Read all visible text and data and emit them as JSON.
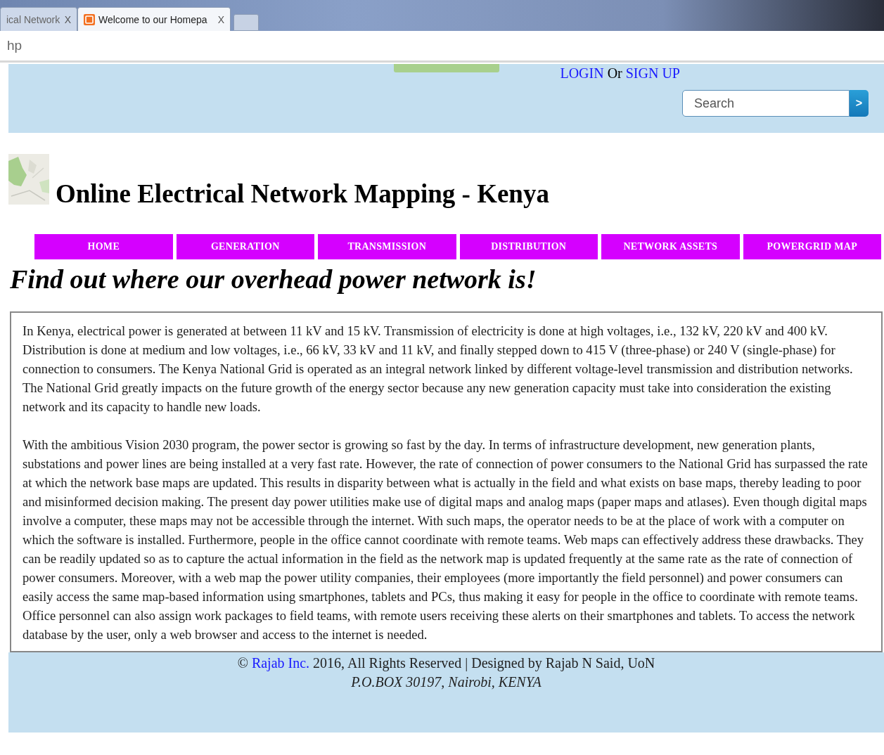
{
  "browser": {
    "tabs": [
      {
        "title": "ical Network",
        "close": "X",
        "selected": false
      },
      {
        "title": "Welcome to our Homepa",
        "close": "X",
        "selected": true
      }
    ],
    "address": "hp"
  },
  "header": {
    "login": "LOGIN",
    "or": "Or",
    "signup": "SIGN UP",
    "search": {
      "placeholder": "Search",
      "button": ">"
    }
  },
  "title": "Online Electrical Network Mapping - Kenya",
  "nav": [
    {
      "label": "HOME"
    },
    {
      "label": "GENERATION"
    },
    {
      "label": "TRANSMISSION"
    },
    {
      "label": "DISTRIBUTION"
    },
    {
      "label": "NETWORK ASSETS"
    },
    {
      "label": "POWERGRID MAP"
    }
  ],
  "tagline": "Find out where our overhead power network is!",
  "paragraphs": [
    "In Kenya, electrical power is generated at between 11 kV and 15 kV. Transmission of electricity is done at high voltages, i.e., 132 kV, 220 kV and 400 kV. Distribution is done at medium and low voltages, i.e., 66 kV, 33 kV and 11 kV, and finally stepped down to 415 V (three-phase) or 240 V (single-phase) for connection to consumers. The Kenya National Grid is operated as an integral network linked by different voltage-level transmission and distribution networks. The National Grid greatly impacts on the future growth of the energy sector because any new generation capacity must take into consideration the existing network and its capacity to handle new loads.",
    "With the ambitious Vision 2030 program, the power sector is growing so fast by the day. In terms of infrastructure development, new generation plants, substations and power lines are being installed at a very fast rate. However, the rate of connection of power consumers to the National Grid has surpassed the rate at which the network base maps are updated. This results in disparity between what is actually in the field and what exists on base maps, thereby leading to poor and misinformed decision making. The present day power utilities make use of digital maps and analog maps (paper maps and atlases). Even though digital maps involve a computer, these maps may not be accessible through the internet. With such maps, the operator needs to be at the place of work with a computer on which the software is installed. Furthermore, people in the office cannot coordinate with remote teams. Web maps can effectively address these drawbacks. They can be readily updated so as to capture the actual information in the field as the network map is updated frequently at the same rate as the rate of connection of power consumers. Moreover, with a web map the power utility companies, their employees (more importantly the field personnel) and power consumers can easily access the same map-based information using smartphones, tablets and PCs, thus making it easy for people in the office to coordinate with remote teams. Office personnel can also assign work packages to field teams, with remote users receiving these alerts on their smartphones and tablets. To access the network database by the user, only a web browser and access to the internet is needed."
  ],
  "footer": {
    "symbol": "©",
    "link": "Rajab Inc.",
    "rest": "2016, All Rights Reserved | Designed by Rajab N Said, UoN",
    "address": "P.O.BOX 30197, Nairobi, KENYA"
  }
}
